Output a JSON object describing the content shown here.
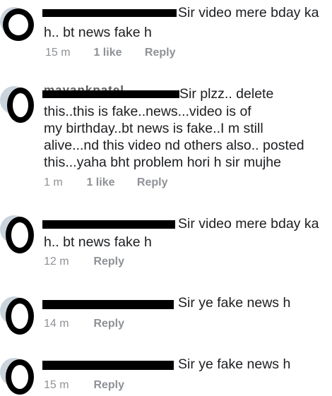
{
  "comments": [
    {
      "name_fragment": "",
      "text_line1": "Sir video mere bday ka",
      "text_rest": "h.. bt news fake h",
      "time": "15 m",
      "likes": "1 like",
      "reply": "Reply"
    },
    {
      "name_fragment": "mayankpatel",
      "text_line1": "Sir plzz.. delete",
      "text_rest": "this..this is fake..news...video is of\nmy birthday..bt news is fake..I m still\nalive...nd this video nd others also.. posted\nthis...yaha bht problem hori h sir mujhe",
      "time": "1 m",
      "likes": "1 like",
      "reply": "Reply"
    },
    {
      "name_fragment": "",
      "text_line1": "Sir video mere bday ka",
      "text_rest": "h.. bt news fake h",
      "time": "12 m",
      "likes": "",
      "reply": "Reply"
    },
    {
      "name_fragment": "",
      "text_line1": "Sir ye fake news h",
      "text_rest": "",
      "time": "14 m",
      "likes": "",
      "reply": "Reply"
    },
    {
      "name_fragment": "",
      "text_line1": "Sir ye fake news h",
      "text_rest": "",
      "time": "15 m",
      "likes": "",
      "reply": "Reply"
    }
  ]
}
